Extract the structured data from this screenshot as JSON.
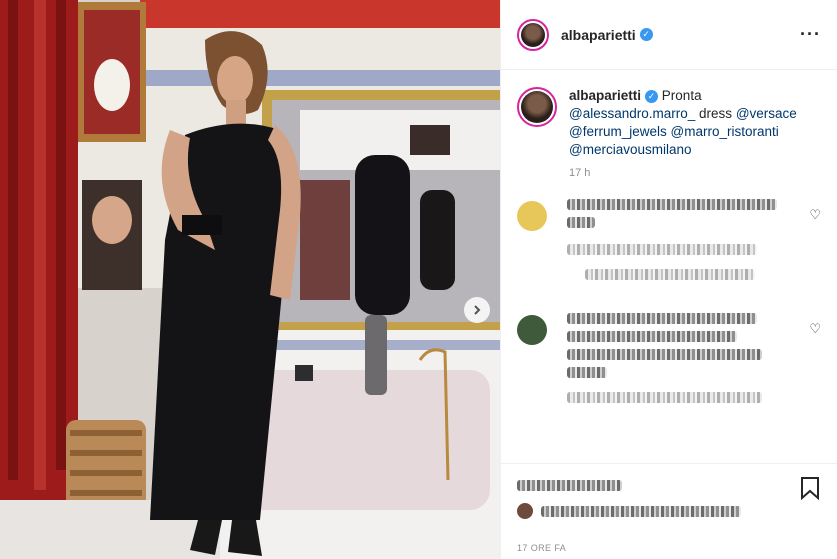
{
  "post": {
    "username": "albaparietti",
    "caption_word": "Pronta",
    "caption_mentions": [
      "@alessandro.marro_",
      "dress",
      "@versace",
      "@ferrum_jewels",
      "@marro_ristoranti",
      "@merciavousmilano"
    ],
    "time": "17 h",
    "time_footer": "17 ORE FA",
    "more_icon": "more-icon",
    "verified_icon": "verified-badge",
    "next_icon": "chevron-right-icon",
    "heart_icon": "heart-outline-icon",
    "save_icon": "bookmark-icon"
  },
  "colors": {
    "verified": "#3897f0",
    "mention": "#00376b",
    "ring": "#d6249f",
    "muted": "#8e8e8e"
  }
}
